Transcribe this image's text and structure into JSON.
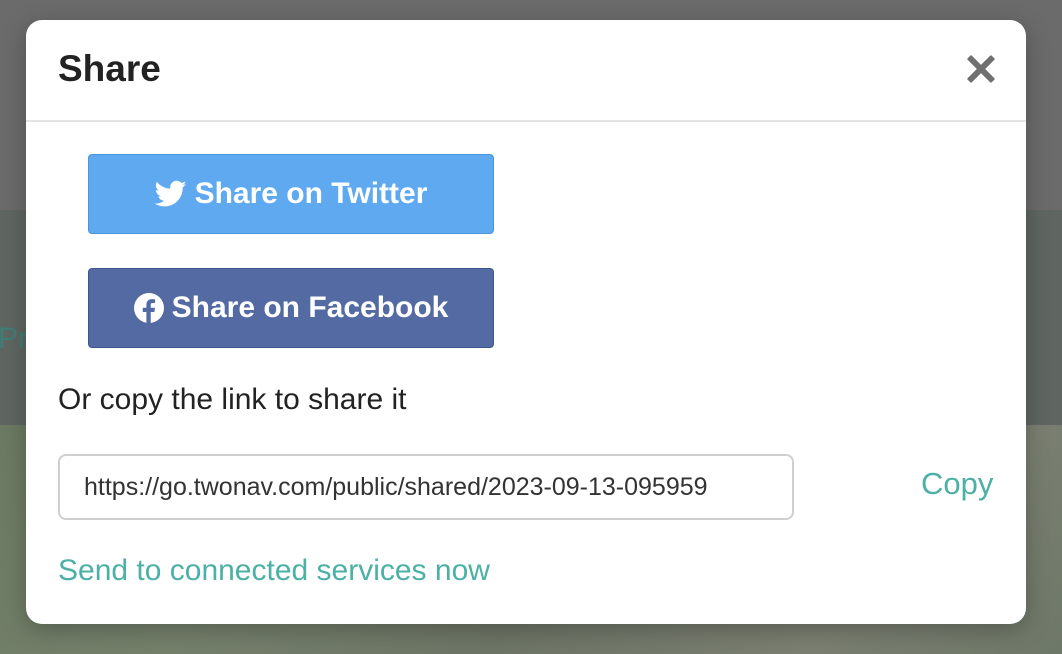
{
  "background": {
    "partial_text": "Pr"
  },
  "modal": {
    "title": "Share",
    "twitter_button": {
      "label": "Share on Twitter",
      "icon": "twitter-bird-icon",
      "color": "#5ea9ef"
    },
    "facebook_button": {
      "label": "Share on Facebook",
      "icon": "facebook-logo-icon",
      "color": "#536aa3"
    },
    "copy_label": "Or copy the link to share it",
    "link_input": {
      "value": "https://go.twonav.com/public/shared/2023-09-13-095959"
    },
    "copy_button_label": "Copy",
    "send_link_label": "Send to connected services now",
    "accent_color": "#4cb0a6"
  }
}
